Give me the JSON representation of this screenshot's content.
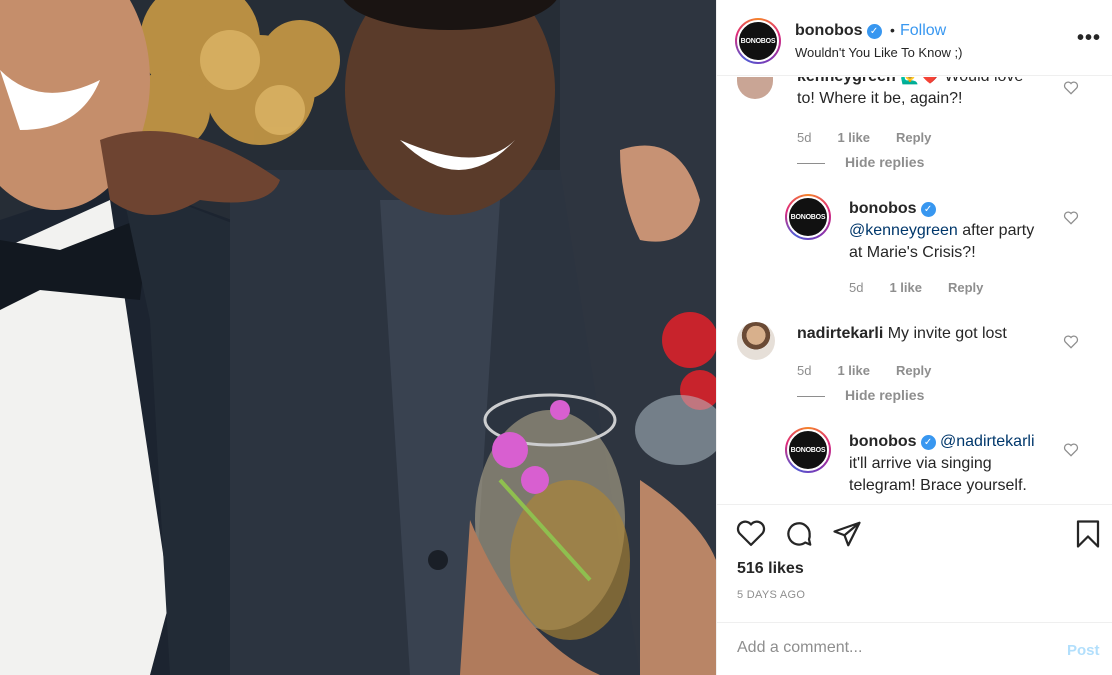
{
  "header": {
    "username": "bonobos",
    "avatar_text": "BONOBOS",
    "separator": "•",
    "follow_label": "Follow",
    "subtitle": "Wouldn't You Like To Know ;)",
    "more_label": "•••"
  },
  "comments": [
    {
      "username": "kenneygreen",
      "text": "Would love to! Where it be, again?!",
      "line1": "Would love",
      "line2": "to! Where it be, again?!",
      "time": "5d",
      "likes": "1 like",
      "reply_label": "Reply",
      "hide_replies": "Hide replies"
    },
    {
      "username": "bonobos",
      "avatar_text": "BONOBOS",
      "mention": "@kenneygreen",
      "line1": "after party",
      "line2": "at Marie's Crisis?!",
      "time": "5d",
      "likes": "1 like",
      "reply_label": "Reply"
    },
    {
      "username": "nadirtekarli",
      "text": "My invite got lost",
      "time": "5d",
      "likes": "1 like",
      "reply_label": "Reply",
      "hide_replies": "Hide replies"
    },
    {
      "username": "bonobos",
      "avatar_text": "BONOBOS",
      "mention": "@nadirtekarli",
      "line1": "it'll arrive via singing",
      "line2": "telegram! Brace yourself."
    }
  ],
  "actions": {
    "likes": "516 likes",
    "posted": "5 DAYS AGO"
  },
  "add_comment": {
    "placeholder": "Add a comment...",
    "post_label": "Post"
  },
  "colors": {
    "link_blue": "#3897f0",
    "mention_blue": "#00376b",
    "muted": "#8e8e8e",
    "post_disabled": "#b2dffc"
  }
}
